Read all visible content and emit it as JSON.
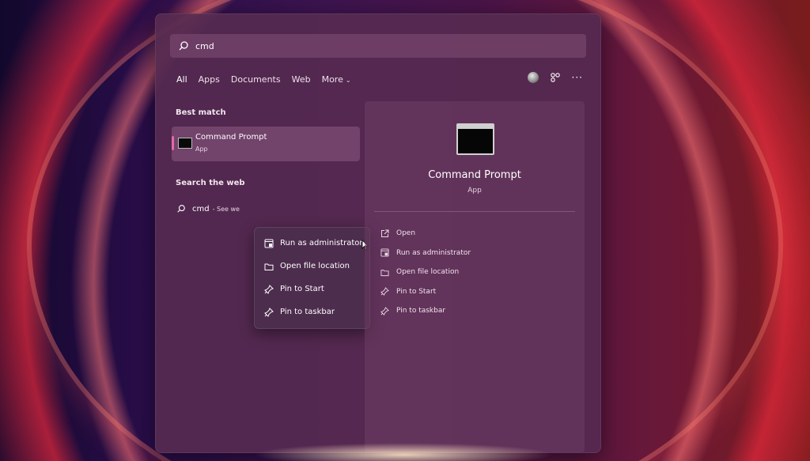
{
  "search": {
    "value": "cmd",
    "icon": "search-icon"
  },
  "filters": {
    "tabs": [
      "All",
      "Apps",
      "Documents",
      "Web",
      "More"
    ],
    "active": "All"
  },
  "left": {
    "best_match_label": "Best match",
    "best_match": {
      "title": "Command Prompt",
      "subtitle": "App"
    },
    "search_web_label": "Search the web",
    "web_result": {
      "query": "cmd",
      "hint": "- See we"
    }
  },
  "context_menu": {
    "items": [
      {
        "label": "Run as administrator",
        "icon": "shield-admin-icon"
      },
      {
        "label": "Open file location",
        "icon": "folder-icon"
      },
      {
        "label": "Pin to Start",
        "icon": "pin-icon"
      },
      {
        "label": "Pin to taskbar",
        "icon": "pin-icon"
      }
    ]
  },
  "preview": {
    "title": "Command Prompt",
    "subtitle": "App",
    "actions": [
      {
        "label": "Open",
        "icon": "open-external-icon"
      },
      {
        "label": "Run as administrator",
        "icon": "shield-admin-icon"
      },
      {
        "label": "Open file location",
        "icon": "folder-icon"
      },
      {
        "label": "Pin to Start",
        "icon": "pin-icon"
      },
      {
        "label": "Pin to taskbar",
        "icon": "pin-icon"
      }
    ]
  },
  "colors": {
    "accent": "#e06aa8",
    "panel": "#562a50"
  }
}
